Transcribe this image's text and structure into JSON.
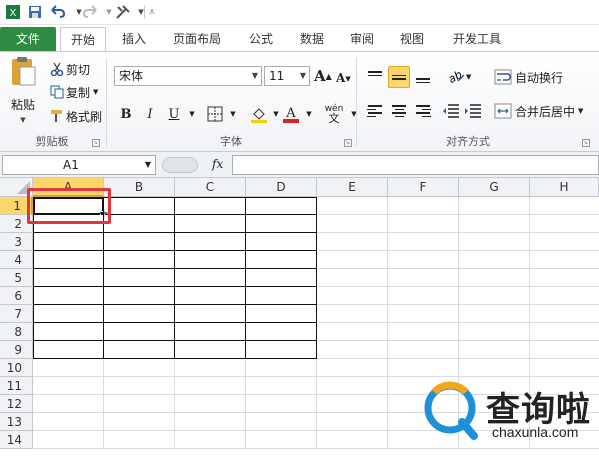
{
  "ribbon_tabs": {
    "file": "文件",
    "home": "开始",
    "insert": "插入",
    "layout": "页面布局",
    "formulas": "公式",
    "data": "数据",
    "review": "审阅",
    "view": "视图",
    "developer": "开发工具"
  },
  "clipboard": {
    "paste": "粘贴",
    "cut": "剪切",
    "copy": "复制",
    "format_painter": "格式刷",
    "group": "剪贴板"
  },
  "font": {
    "family": "宋体",
    "size": "11",
    "grow": "A",
    "shrink": "A",
    "bold": "B",
    "italic": "I",
    "underline": "U",
    "group": "字体",
    "phonetic": "wén"
  },
  "alignment": {
    "wrap_text": "自动换行",
    "merge_center": "合并后居中",
    "group": "对齐方式"
  },
  "formula_bar": {
    "name_box": "A1",
    "fx": "fx",
    "formula": ""
  },
  "sheet": {
    "columns": [
      "A",
      "B",
      "C",
      "D",
      "E",
      "F",
      "G",
      "H"
    ],
    "rows": [
      "1",
      "2",
      "3",
      "4",
      "5",
      "6",
      "7",
      "8",
      "9",
      "10",
      "11",
      "12",
      "13",
      "14"
    ],
    "selected_cell": "A1"
  },
  "watermark": {
    "title": "查询啦",
    "url": "chaxunla.com"
  },
  "colors": {
    "accent_file_tab": "#2f8a42",
    "selection": "#fbd66a",
    "highlight_box": "#e0373a",
    "font_color_bar": "#e02020",
    "fill_color_bar": "#f5d000"
  }
}
